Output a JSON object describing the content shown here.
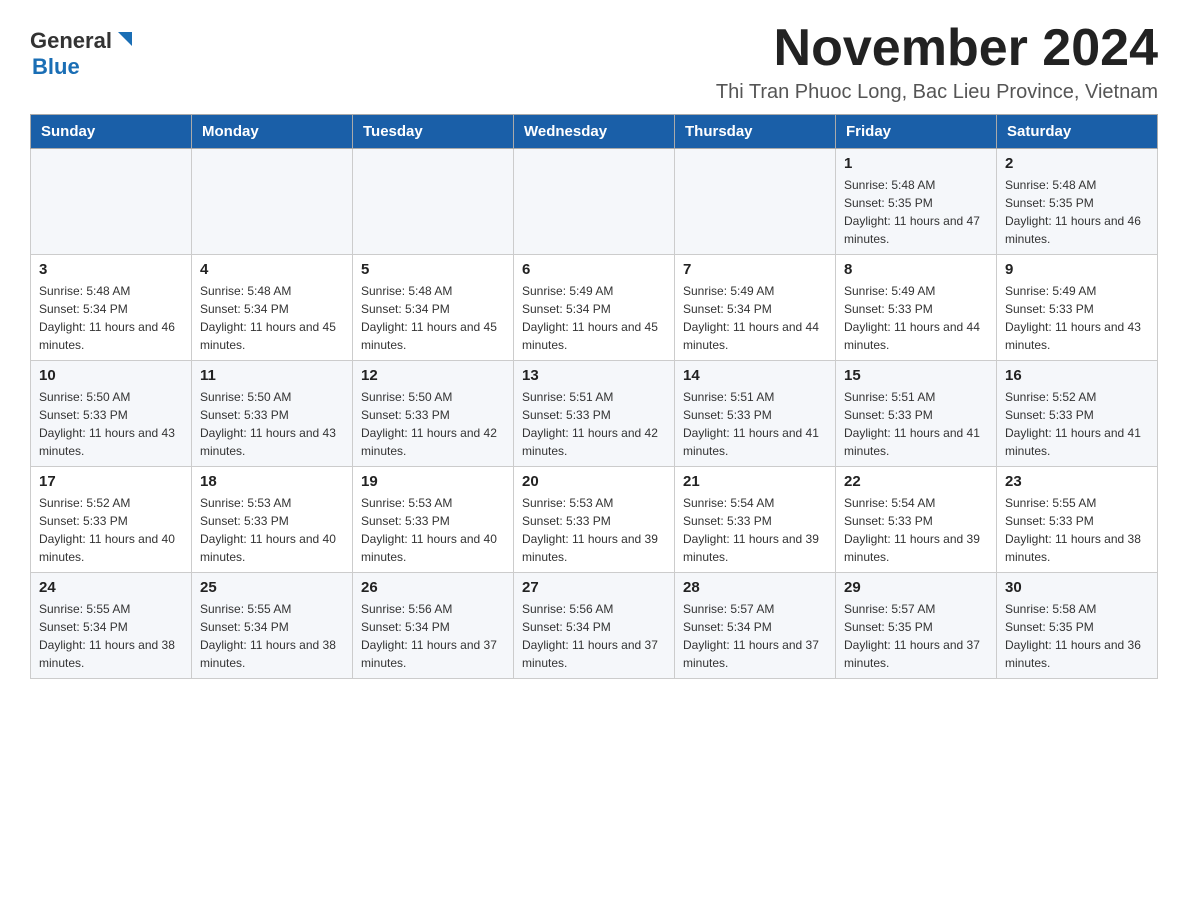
{
  "logo": {
    "text_general": "General",
    "text_blue": "Blue"
  },
  "header": {
    "title": "November 2024",
    "subtitle": "Thi Tran Phuoc Long, Bac Lieu Province, Vietnam"
  },
  "weekdays": [
    "Sunday",
    "Monday",
    "Tuesday",
    "Wednesday",
    "Thursday",
    "Friday",
    "Saturday"
  ],
  "weeks": [
    [
      {
        "day": "",
        "sunrise": "",
        "sunset": "",
        "daylight": ""
      },
      {
        "day": "",
        "sunrise": "",
        "sunset": "",
        "daylight": ""
      },
      {
        "day": "",
        "sunrise": "",
        "sunset": "",
        "daylight": ""
      },
      {
        "day": "",
        "sunrise": "",
        "sunset": "",
        "daylight": ""
      },
      {
        "day": "",
        "sunrise": "",
        "sunset": "",
        "daylight": ""
      },
      {
        "day": "1",
        "sunrise": "Sunrise: 5:48 AM",
        "sunset": "Sunset: 5:35 PM",
        "daylight": "Daylight: 11 hours and 47 minutes."
      },
      {
        "day": "2",
        "sunrise": "Sunrise: 5:48 AM",
        "sunset": "Sunset: 5:35 PM",
        "daylight": "Daylight: 11 hours and 46 minutes."
      }
    ],
    [
      {
        "day": "3",
        "sunrise": "Sunrise: 5:48 AM",
        "sunset": "Sunset: 5:34 PM",
        "daylight": "Daylight: 11 hours and 46 minutes."
      },
      {
        "day": "4",
        "sunrise": "Sunrise: 5:48 AM",
        "sunset": "Sunset: 5:34 PM",
        "daylight": "Daylight: 11 hours and 45 minutes."
      },
      {
        "day": "5",
        "sunrise": "Sunrise: 5:48 AM",
        "sunset": "Sunset: 5:34 PM",
        "daylight": "Daylight: 11 hours and 45 minutes."
      },
      {
        "day": "6",
        "sunrise": "Sunrise: 5:49 AM",
        "sunset": "Sunset: 5:34 PM",
        "daylight": "Daylight: 11 hours and 45 minutes."
      },
      {
        "day": "7",
        "sunrise": "Sunrise: 5:49 AM",
        "sunset": "Sunset: 5:34 PM",
        "daylight": "Daylight: 11 hours and 44 minutes."
      },
      {
        "day": "8",
        "sunrise": "Sunrise: 5:49 AM",
        "sunset": "Sunset: 5:33 PM",
        "daylight": "Daylight: 11 hours and 44 minutes."
      },
      {
        "day": "9",
        "sunrise": "Sunrise: 5:49 AM",
        "sunset": "Sunset: 5:33 PM",
        "daylight": "Daylight: 11 hours and 43 minutes."
      }
    ],
    [
      {
        "day": "10",
        "sunrise": "Sunrise: 5:50 AM",
        "sunset": "Sunset: 5:33 PM",
        "daylight": "Daylight: 11 hours and 43 minutes."
      },
      {
        "day": "11",
        "sunrise": "Sunrise: 5:50 AM",
        "sunset": "Sunset: 5:33 PM",
        "daylight": "Daylight: 11 hours and 43 minutes."
      },
      {
        "day": "12",
        "sunrise": "Sunrise: 5:50 AM",
        "sunset": "Sunset: 5:33 PM",
        "daylight": "Daylight: 11 hours and 42 minutes."
      },
      {
        "day": "13",
        "sunrise": "Sunrise: 5:51 AM",
        "sunset": "Sunset: 5:33 PM",
        "daylight": "Daylight: 11 hours and 42 minutes."
      },
      {
        "day": "14",
        "sunrise": "Sunrise: 5:51 AM",
        "sunset": "Sunset: 5:33 PM",
        "daylight": "Daylight: 11 hours and 41 minutes."
      },
      {
        "day": "15",
        "sunrise": "Sunrise: 5:51 AM",
        "sunset": "Sunset: 5:33 PM",
        "daylight": "Daylight: 11 hours and 41 minutes."
      },
      {
        "day": "16",
        "sunrise": "Sunrise: 5:52 AM",
        "sunset": "Sunset: 5:33 PM",
        "daylight": "Daylight: 11 hours and 41 minutes."
      }
    ],
    [
      {
        "day": "17",
        "sunrise": "Sunrise: 5:52 AM",
        "sunset": "Sunset: 5:33 PM",
        "daylight": "Daylight: 11 hours and 40 minutes."
      },
      {
        "day": "18",
        "sunrise": "Sunrise: 5:53 AM",
        "sunset": "Sunset: 5:33 PM",
        "daylight": "Daylight: 11 hours and 40 minutes."
      },
      {
        "day": "19",
        "sunrise": "Sunrise: 5:53 AM",
        "sunset": "Sunset: 5:33 PM",
        "daylight": "Daylight: 11 hours and 40 minutes."
      },
      {
        "day": "20",
        "sunrise": "Sunrise: 5:53 AM",
        "sunset": "Sunset: 5:33 PM",
        "daylight": "Daylight: 11 hours and 39 minutes."
      },
      {
        "day": "21",
        "sunrise": "Sunrise: 5:54 AM",
        "sunset": "Sunset: 5:33 PM",
        "daylight": "Daylight: 11 hours and 39 minutes."
      },
      {
        "day": "22",
        "sunrise": "Sunrise: 5:54 AM",
        "sunset": "Sunset: 5:33 PM",
        "daylight": "Daylight: 11 hours and 39 minutes."
      },
      {
        "day": "23",
        "sunrise": "Sunrise: 5:55 AM",
        "sunset": "Sunset: 5:33 PM",
        "daylight": "Daylight: 11 hours and 38 minutes."
      }
    ],
    [
      {
        "day": "24",
        "sunrise": "Sunrise: 5:55 AM",
        "sunset": "Sunset: 5:34 PM",
        "daylight": "Daylight: 11 hours and 38 minutes."
      },
      {
        "day": "25",
        "sunrise": "Sunrise: 5:55 AM",
        "sunset": "Sunset: 5:34 PM",
        "daylight": "Daylight: 11 hours and 38 minutes."
      },
      {
        "day": "26",
        "sunrise": "Sunrise: 5:56 AM",
        "sunset": "Sunset: 5:34 PM",
        "daylight": "Daylight: 11 hours and 37 minutes."
      },
      {
        "day": "27",
        "sunrise": "Sunrise: 5:56 AM",
        "sunset": "Sunset: 5:34 PM",
        "daylight": "Daylight: 11 hours and 37 minutes."
      },
      {
        "day": "28",
        "sunrise": "Sunrise: 5:57 AM",
        "sunset": "Sunset: 5:34 PM",
        "daylight": "Daylight: 11 hours and 37 minutes."
      },
      {
        "day": "29",
        "sunrise": "Sunrise: 5:57 AM",
        "sunset": "Sunset: 5:35 PM",
        "daylight": "Daylight: 11 hours and 37 minutes."
      },
      {
        "day": "30",
        "sunrise": "Sunrise: 5:58 AM",
        "sunset": "Sunset: 5:35 PM",
        "daylight": "Daylight: 11 hours and 36 minutes."
      }
    ]
  ]
}
